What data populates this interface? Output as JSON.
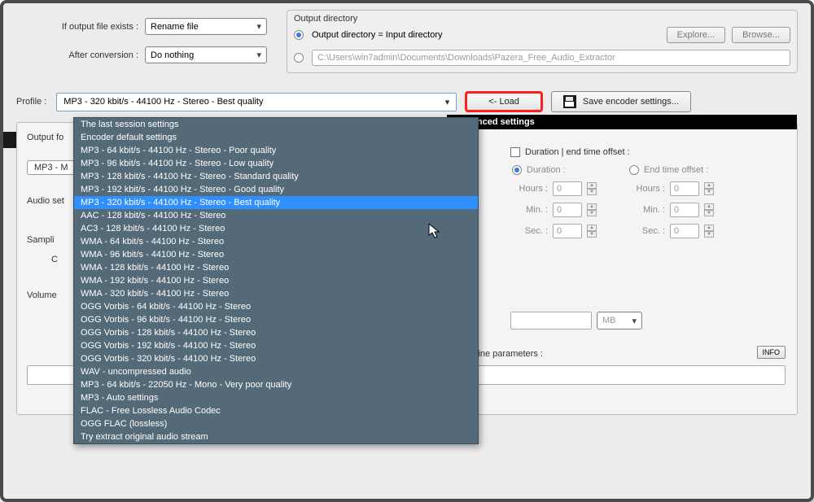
{
  "topLeft": {
    "ifExistsLabel": "If output file exists :",
    "ifExistsValue": "Rename file",
    "afterConvLabel": "After conversion :",
    "afterConvValue": "Do nothing"
  },
  "outdir": {
    "title": "Output directory",
    "sameAsInput": "Output directory = Input directory",
    "path": "C:\\Users\\win7admin\\Documents\\Downloads\\Pazera_Free_Audio_Extractor",
    "explore": "Explore...",
    "browse": "Browse..."
  },
  "profile": {
    "label": "Profile :",
    "value": "MP3 - 320 kbit/s - 44100 Hz - Stereo - Best quality",
    "load": "<- Load",
    "save": "Save encoder settings...",
    "options": [
      "The last session settings",
      "Encoder default settings",
      "MP3 - 64 kbit/s - 44100 Hz - Stereo - Poor quality",
      "MP3 - 96 kbit/s - 44100 Hz - Stereo - Low quality",
      "MP3 - 128 kbit/s - 44100 Hz - Stereo - Standard quality",
      "MP3 - 192 kbit/s - 44100 Hz - Stereo - Good quality",
      "MP3 - 320 kbit/s - 44100 Hz - Stereo - Best quality",
      "AAC - 128 kbit/s - 44100 Hz - Stereo",
      "AC3 - 128 kbit/s - 44100 Hz - Stereo",
      "WMA - 64 kbit/s - 44100 Hz - Stereo",
      "WMA - 96 kbit/s - 44100 Hz - Stereo",
      "WMA - 128 kbit/s - 44100 Hz - Stereo",
      "WMA - 192 kbit/s - 44100 Hz - Stereo",
      "WMA - 320 kbit/s - 44100 Hz - Stereo",
      "OGG Vorbis - 64 kbit/s - 44100 Hz - Stereo",
      "OGG Vorbis - 96 kbit/s - 44100 Hz - Stereo",
      "OGG Vorbis - 128 kbit/s - 44100 Hz - Stereo",
      "OGG Vorbis - 192 kbit/s - 44100 Hz - Stereo",
      "OGG Vorbis - 320 kbit/s - 44100 Hz - Stereo",
      "WAV - uncompressed audio",
      "MP3 - 64 kbit/s - 22050 Hz - Mono - Very poor quality",
      "MP3 - Auto settings",
      "FLAC - Free Lossless Audio Codec",
      "OGG FLAC (lossless)",
      "Try extract original audio stream"
    ],
    "selectedIndex": 6
  },
  "settings": {
    "advanced": "Advanced settings",
    "outputFor": "Output fo",
    "mp3Badge": "MP3 - M",
    "audioSet": "Audio set",
    "sampli": "Sampli",
    "c": "C",
    "volume": "Volume",
    "mb": "MB",
    "durationHeader": "Duration | end time offset :",
    "durationLabel": "Duration :",
    "endTimeLabel": "End time offset :",
    "hours": "Hours :",
    "min": "Min. :",
    "sec": "Sec. :",
    "zero": "0",
    "cmdline": "line parameters :",
    "info": "INFO"
  }
}
